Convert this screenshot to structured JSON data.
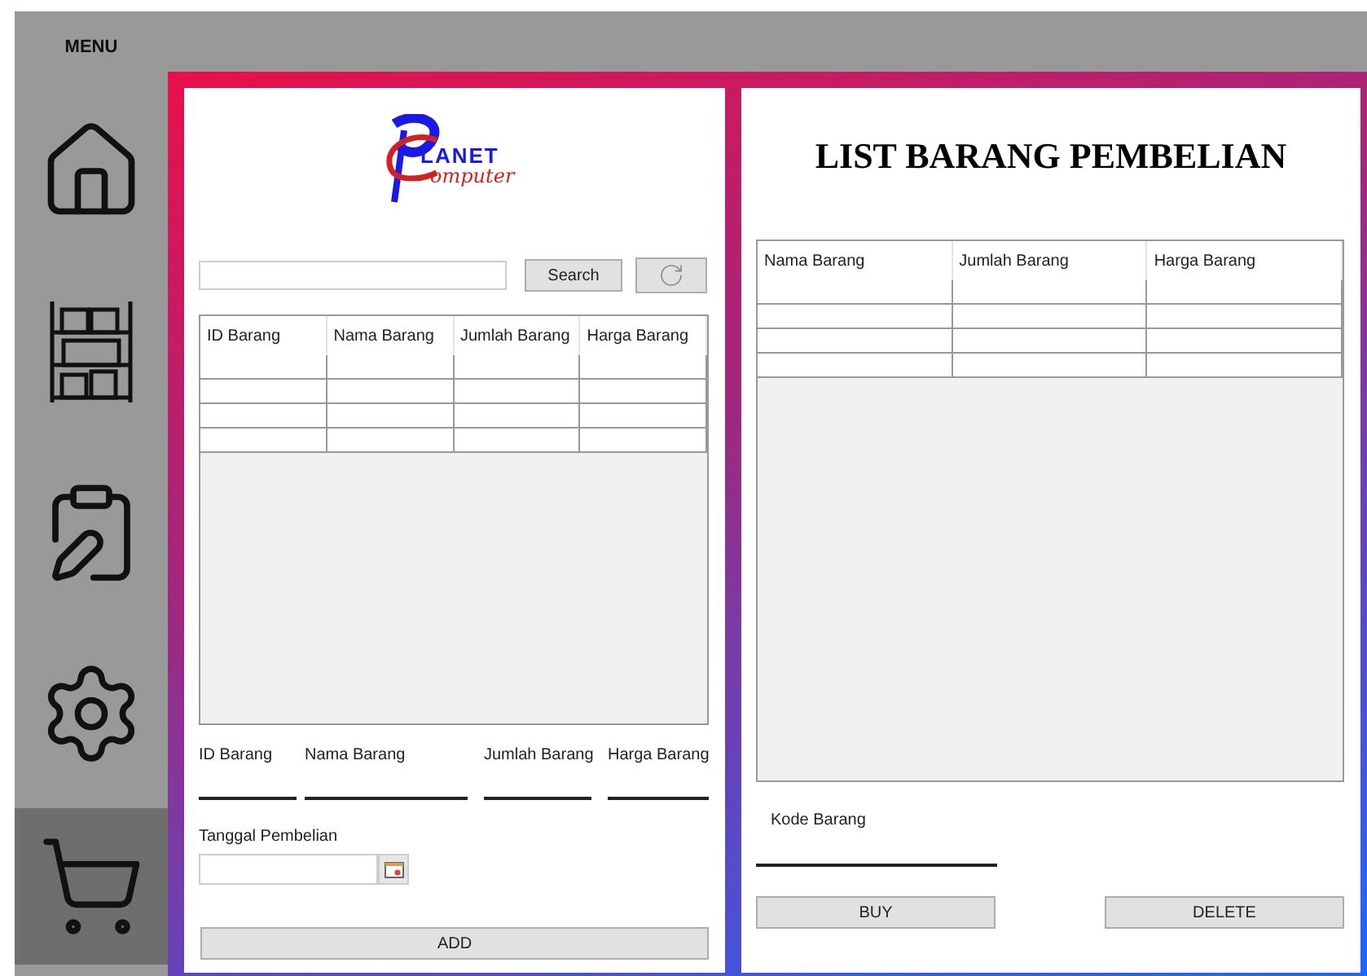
{
  "sidebar": {
    "title": "MENU",
    "items": [
      {
        "kind": "home",
        "selected": false
      },
      {
        "kind": "shelf",
        "selected": false
      },
      {
        "kind": "clipboard",
        "selected": false
      },
      {
        "kind": "gear",
        "selected": false
      },
      {
        "kind": "cart",
        "selected": true
      }
    ]
  },
  "logo": {
    "top": "LANET",
    "bottom": "omputer"
  },
  "search": {
    "button": "Search"
  },
  "stock_table": {
    "columns": [
      "ID Barang",
      "Nama Barang",
      "Jumlah Barang",
      "Harga Barang"
    ]
  },
  "form": {
    "fields": [
      {
        "label": "ID Barang"
      },
      {
        "label": "Nama Barang"
      },
      {
        "label": "Jumlah Barang"
      },
      {
        "label": "Harga Barang"
      }
    ],
    "date_label": "Tanggal Pembelian",
    "add_button": "ADD"
  },
  "purchase": {
    "title": "LIST BARANG PEMBELIAN",
    "columns": [
      "Nama Barang",
      "Jumlah Barang",
      "Harga Barang"
    ],
    "code_label": "Kode Barang",
    "buy_button": "BUY",
    "delete_button": "DELETE"
  }
}
